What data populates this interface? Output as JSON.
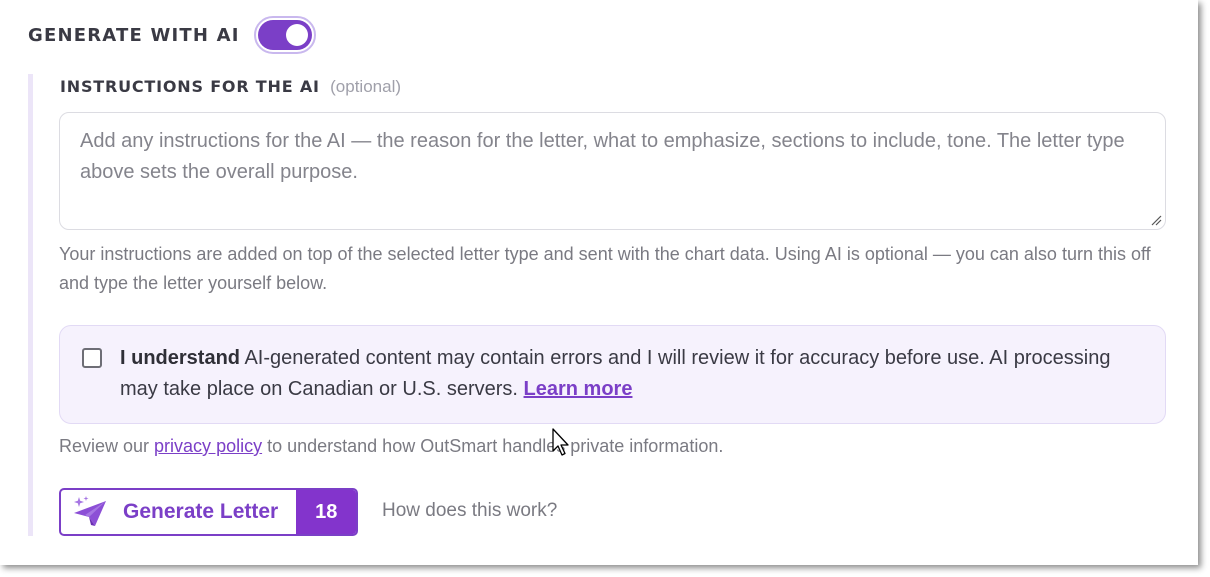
{
  "header": {
    "title": "GENERATE WITH AI",
    "toggle_state": "on"
  },
  "instructions": {
    "label": "INSTRUCTIONS FOR THE AI",
    "optional_tag": "(optional)",
    "placeholder": "Add any instructions for the AI — the reason for the letter, what to emphasize, sections to include, tone. The letter type above sets the overall purpose.",
    "value": "",
    "help_text": "Your instructions are added on top of the selected letter type and sent with the chart data. Using AI is optional — you can also turn this off and type the letter yourself below."
  },
  "consent": {
    "checked": false,
    "bold_text": "I understand",
    "text": " AI-generated content may contain errors and I will review it for accuracy before use. AI processing may take place on Canadian or U.S. servers. ",
    "link_text": "Learn more"
  },
  "privacy": {
    "prefix": "Review our ",
    "link_text": "privacy policy",
    "suffix": " to understand how OutSmart handles private information."
  },
  "generate_button": {
    "label": "Generate Letter",
    "count": "18",
    "icon": "paper-plane-sparkle-icon"
  },
  "help_link": "How does this work?",
  "colors": {
    "accent": "#7b3fc7",
    "accent_dark": "#8334cc",
    "consent_bg": "#f6f2fd",
    "muted_text": "#7a7a82"
  }
}
